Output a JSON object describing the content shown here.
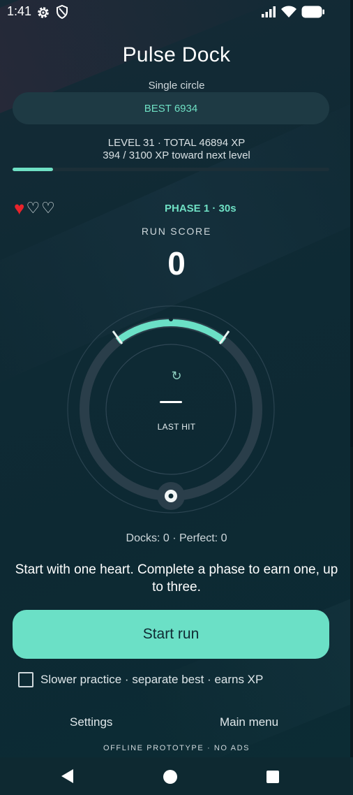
{
  "status_bar": {
    "time": "1:41",
    "left_icons": [
      "settings-gear-icon",
      "shield-icon"
    ],
    "right_icons": [
      "signal-icon",
      "wifi-icon",
      "battery-icon"
    ]
  },
  "header": {
    "title": "Pulse Dock",
    "mode": "Single circle",
    "best": "BEST 6934"
  },
  "progress": {
    "level_line": "LEVEL 31 · TOTAL 46894 XP",
    "xp_line": "394 / 3100 XP toward next level",
    "xp_fraction": 0.127
  },
  "game": {
    "hearts": {
      "filled": 1,
      "total": 3
    },
    "phase": "PHASE 1 · 30s",
    "run_score_label": "RUN SCORE",
    "run_score": "0",
    "last_hit_value": "—",
    "last_hit_label": "LAST HIT",
    "stats": "Docks: 0 · Perfect: 0",
    "hint": "Start with one heart. Complete a phase to earn one, up to three."
  },
  "actions": {
    "start_label": "Start run",
    "practice_label": "Slower practice · separate best · earns XP",
    "practice_checked": false,
    "settings_label": "Settings",
    "main_menu_label": "Main menu"
  },
  "footer": "OFFLINE PROTOTYPE · NO ADS",
  "colors": {
    "accent": "#6be0c6",
    "heart": "#e8232b",
    "background": "#0e2a33"
  }
}
